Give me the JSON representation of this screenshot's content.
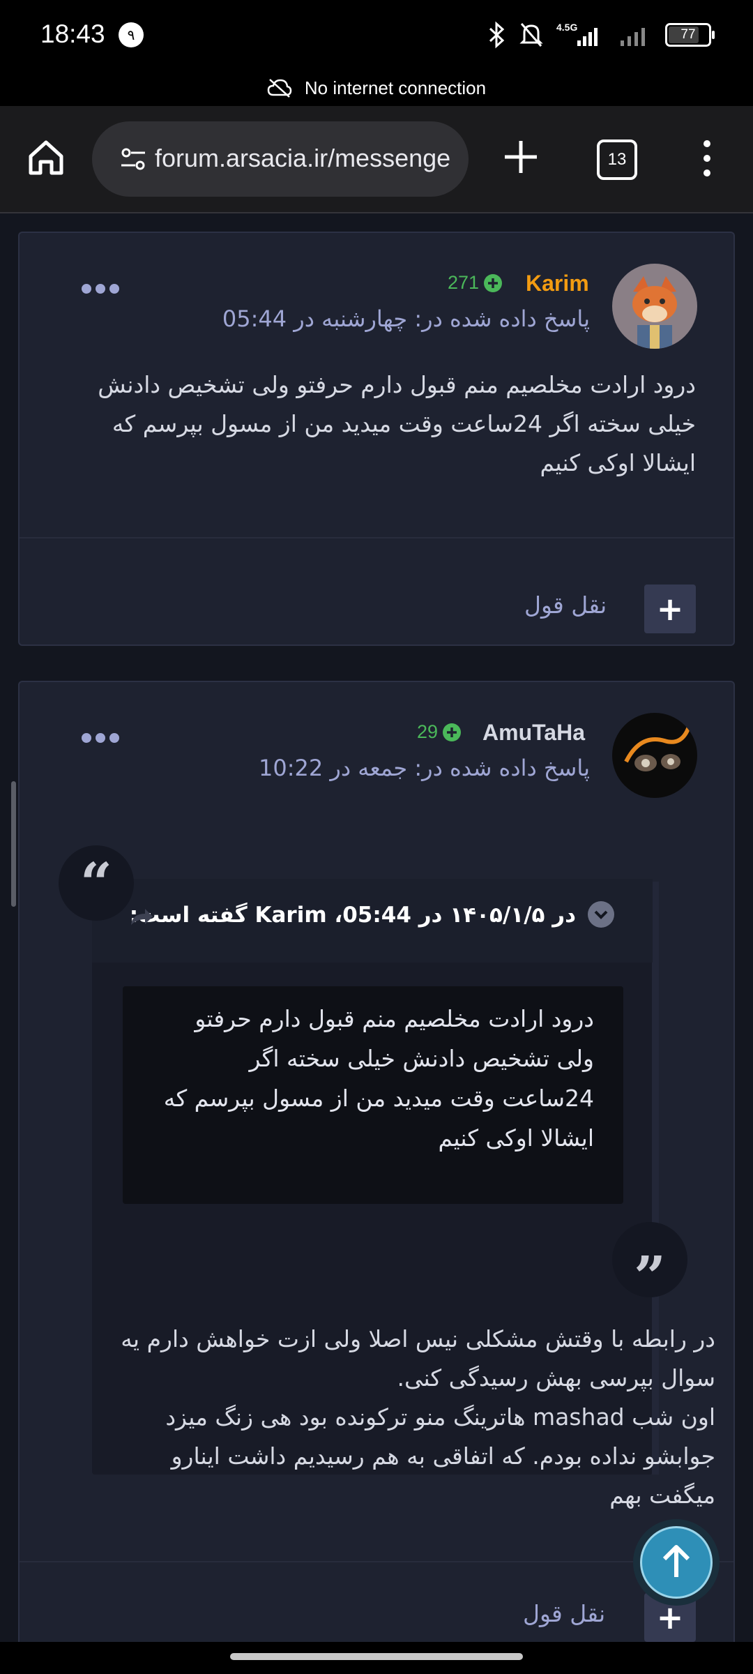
{
  "status_bar": {
    "time": "18:43",
    "notification_count": "۹",
    "network": "4.5G",
    "battery": "77",
    "battery_level_percent": 77
  },
  "connection_banner": {
    "text": "No internet connection"
  },
  "browser": {
    "url": "forum.arsacia.ir/messenge",
    "tab_count": "13",
    "icons": [
      "home-icon",
      "site-settings-icon",
      "new-tab-plus-icon",
      "tab-switcher-icon",
      "overflow-menu-icon"
    ]
  },
  "posts": [
    {
      "username": "Karim",
      "username_color": "#f39c12",
      "reputation": "271",
      "date": "پاسخ داده شده در: چهارشنبه در 05:44",
      "body": [
        "درود ارادت مخلصیم منم قبول دارم حرفتو ولی تشخیص دادنش",
        "خیلی سخته اگر 24ساعت وقت میدید من از مسول بپرسم که",
        "ایشالا اوکی کنیم"
      ],
      "quote_label": "نقل قول",
      "multiquote_label": "+"
    },
    {
      "username": "AmuTaHa",
      "username_color": "#d6d9e3",
      "reputation": "29",
      "date": "پاسخ داده شده در: جمعه در 10:22",
      "quote": {
        "header": "در ۱۴۰۵/۱/۵ در 05:44، Karim گفته است:",
        "body": [
          "درود ارادت مخلصیم منم قبول دارم حرفتو",
          "ولی تشخیص دادنش خیلی سخته اگر",
          "24ساعت وقت میدید من از مسول بپرسم که",
          "ایشالا اوکی کنیم"
        ]
      },
      "body": [
        "در رابطه با وقتش مشکلی نیس اصلا ولی ازت خواهش دارم یه",
        "سوال بپرسی بهش رسیدگی کنی.",
        "اون شب mashad هاترینگ منو ترکونده بود هی زنگ میزد",
        "جوابشو نداده بودم. که اتفاقی به هم رسیدیم داشت اینارو",
        "میگفت بهم"
      ],
      "quote_label": "نقل قول",
      "multiquote_label": "+"
    }
  ],
  "colors": {
    "background": "#13161f",
    "card": "#1e2230",
    "accent_link": "#9fa6d4",
    "reputation_green": "#4bb85a",
    "fab": "#2e8fb7"
  }
}
